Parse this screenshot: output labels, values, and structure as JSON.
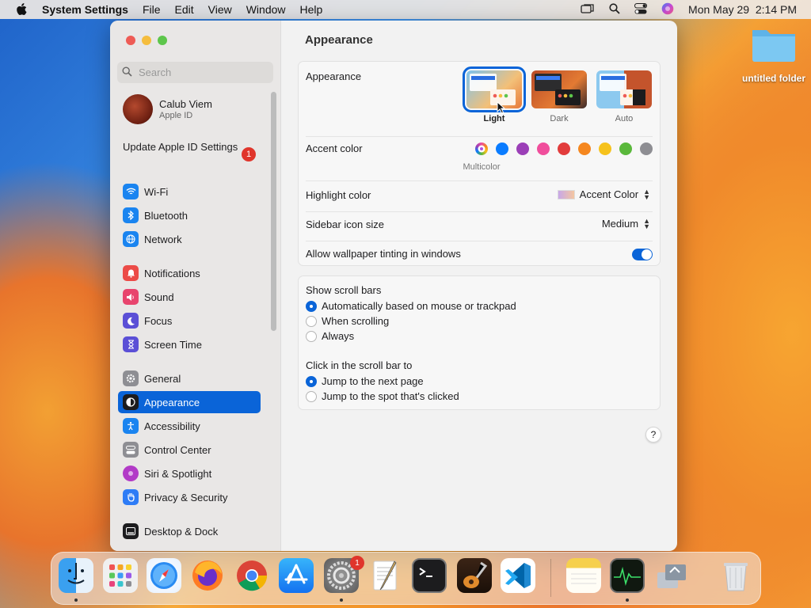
{
  "menubar": {
    "app_name": "System Settings",
    "menus": [
      "File",
      "Edit",
      "View",
      "Window",
      "Help"
    ],
    "clock": "Mon May 29  2:14 PM"
  },
  "desktop": {
    "folder_label": "untitled folder"
  },
  "sidebar": {
    "search_placeholder": "Search",
    "profile": {
      "name": "Calub Viem",
      "subtitle": "Apple ID"
    },
    "update": {
      "label": "Update Apple ID Settings",
      "badge": "1"
    },
    "items": [
      {
        "label": "Wi-Fi",
        "color": "#1a84f0"
      },
      {
        "label": "Bluetooth",
        "color": "#1a84f0"
      },
      {
        "label": "Network",
        "color": "#1a84f0"
      },
      {
        "label": "Notifications",
        "color": "#ec4b47"
      },
      {
        "label": "Sound",
        "color": "#e8446d"
      },
      {
        "label": "Focus",
        "color": "#5b4fd6"
      },
      {
        "label": "Screen Time",
        "color": "#5b4fd6"
      },
      {
        "label": "General",
        "color": "#8e8e93"
      },
      {
        "label": "Appearance",
        "color": "#1c1c1e"
      },
      {
        "label": "Accessibility",
        "color": "#1a84f0"
      },
      {
        "label": "Control Center",
        "color": "#8e8e93"
      },
      {
        "label": "Siri & Spotlight",
        "color": "#b23ac7"
      },
      {
        "label": "Privacy & Security",
        "color": "#2e7cf6"
      },
      {
        "label": "Desktop & Dock",
        "color": "#1c1c1e"
      }
    ]
  },
  "main": {
    "title": "Appearance",
    "appearance": {
      "label": "Appearance",
      "options": [
        "Light",
        "Dark",
        "Auto"
      ],
      "selected": "Light"
    },
    "accent": {
      "label": "Accent color",
      "selected_label": "Multicolor",
      "colors": [
        "#b44fe0",
        "#0a7cff",
        "#9b3fb7",
        "#f04e9c",
        "#e23c3c",
        "#f5871f",
        "#f6c21c",
        "#5ab83b",
        "#8e8e93"
      ]
    },
    "highlight": {
      "label": "Highlight color",
      "value": "Accent Color"
    },
    "sidebar_icon_size": {
      "label": "Sidebar icon size",
      "value": "Medium"
    },
    "wallpaper_tinting": {
      "label": "Allow wallpaper tinting in windows",
      "on": true
    },
    "scroll_bars": {
      "label": "Show scroll bars",
      "options": [
        "Automatically based on mouse or trackpad",
        "When scrolling",
        "Always"
      ],
      "selected": 0
    },
    "click_scroll": {
      "label": "Click in the scroll bar to",
      "options": [
        "Jump to the next page",
        "Jump to the spot that's clicked"
      ],
      "selected": 0
    },
    "help": "?"
  },
  "dock": {
    "settings_badge": "1",
    "apps": [
      "Finder",
      "Launchpad",
      "Safari",
      "Firefox",
      "Chrome",
      "App Store",
      "System Settings",
      "TextEdit",
      "Terminal",
      "GarageBand",
      "VS Code",
      "Notes",
      "Activity Monitor",
      "Migration Assistant",
      "Trash"
    ]
  }
}
